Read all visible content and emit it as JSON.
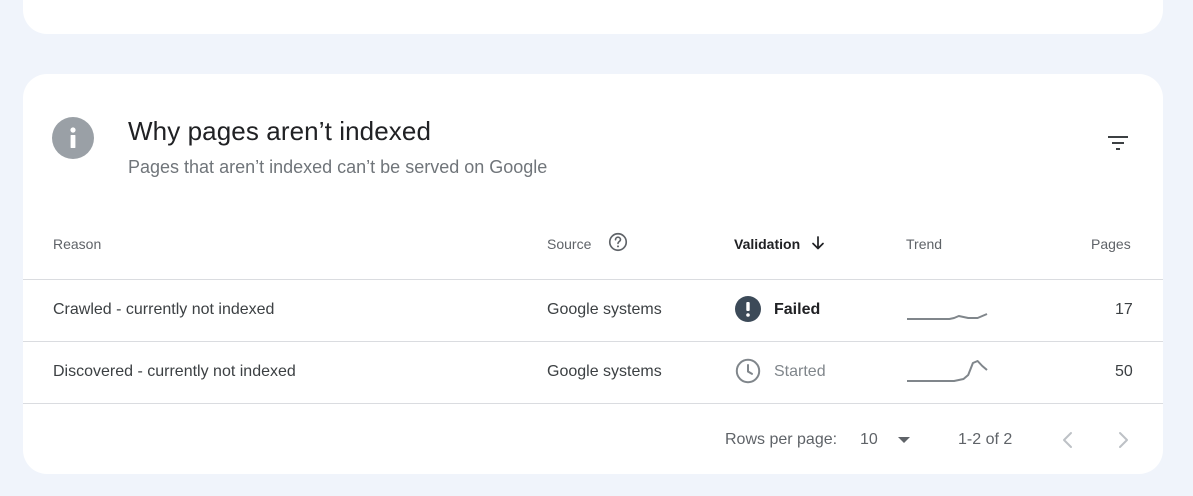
{
  "card": {
    "title": "Why pages aren’t indexed",
    "subtitle": "Pages that aren’t indexed can’t be served on Google",
    "header_icon": "info-icon",
    "filter_icon": "filter-icon"
  },
  "table": {
    "columns": {
      "reason": "Reason",
      "source": "Source",
      "validation": "Validation",
      "trend": "Trend",
      "pages": "Pages"
    },
    "sorted_by": "Validation",
    "sort_direction": "descending",
    "rows": [
      {
        "reason": "Crawled - currently not indexed",
        "source": "Google systems",
        "validation": "Failed",
        "validation_icon": "failed-exclamation-icon",
        "pages": "17",
        "trend": [
          0,
          0,
          0,
          0,
          0,
          0,
          0,
          0,
          0,
          0,
          0.05,
          0.15,
          0.1,
          0.05,
          0.05,
          0.05,
          0.15,
          0.25
        ]
      },
      {
        "reason": "Discovered - currently not indexed",
        "source": "Google systems",
        "validation": "Started",
        "validation_icon": "clock-icon",
        "pages": "50",
        "trend": [
          0,
          0,
          0,
          0,
          0,
          0,
          0,
          0,
          0,
          0,
          0,
          0.05,
          0.1,
          0.3,
          0.9,
          1.0,
          0.75,
          0.55
        ]
      }
    ]
  },
  "pagination": {
    "rows_per_page_label": "Rows per page:",
    "rows_per_page_value": "10",
    "range": "1-2 of 2"
  },
  "colors": {
    "background": "#f0f4fb",
    "card": "#ffffff",
    "failed_icon": "#3c4a58",
    "muted_icon": "#9aa0a6",
    "trend_line": "#80868b",
    "divider": "#dadce0"
  }
}
